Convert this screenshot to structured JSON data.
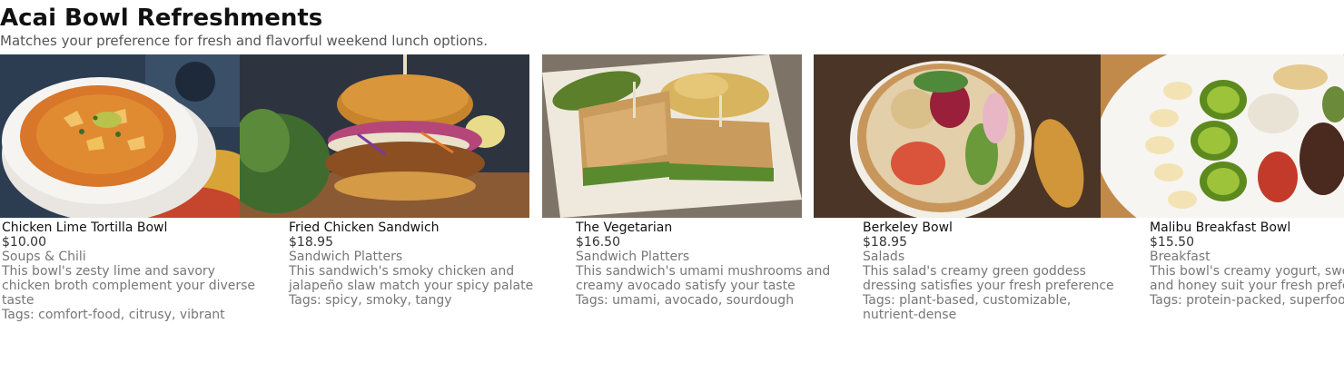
{
  "header": {
    "title": "Acai Bowl Refreshments",
    "subtitle": "Matches your preference for fresh and flavorful weekend lunch options."
  },
  "items": [
    {
      "name": "Chicken Lime Tortilla Bowl",
      "price": "$10.00",
      "category": "Soups & Chili",
      "description": "This bowl's zesty lime and savory chicken broth complement your diverse taste",
      "tags": "Tags: comfort-food, citrusy, vibrant",
      "image": "soup-bowl-photo"
    },
    {
      "name": "Fried Chicken Sandwich",
      "price": "$18.95",
      "category": "Sandwich Platters",
      "description": "This sandwich's smoky chicken and jalapeño slaw match your spicy palate",
      "tags": "Tags: spicy, smoky, tangy",
      "image": "chicken-sandwich-photo"
    },
    {
      "name": "The Vegetarian",
      "price": "$16.50",
      "category": "Sandwich Platters",
      "description": "This sandwich's umami mushrooms and creamy avocado satisfy your taste",
      "tags": "Tags: umami, avocado, sourdough",
      "image": "vegetarian-sandwich-photo"
    },
    {
      "name": "Berkeley Bowl",
      "price": "$18.95",
      "category": "Salads",
      "description": "This salad's creamy green goddess dressing satisfies your fresh preference",
      "tags": "Tags: plant-based, customizable, nutrient-dense",
      "image": "salad-bowl-photo"
    },
    {
      "name": "Malibu Breakfast Bowl",
      "price": "$15.50",
      "category": "Breakfast",
      "description": "This bowl's creamy yogurt, sweet fruits, and honey suit your fresh preference",
      "tags": "Tags: protein-packed, superfood, textural",
      "image": "breakfast-bowl-photo"
    }
  ]
}
